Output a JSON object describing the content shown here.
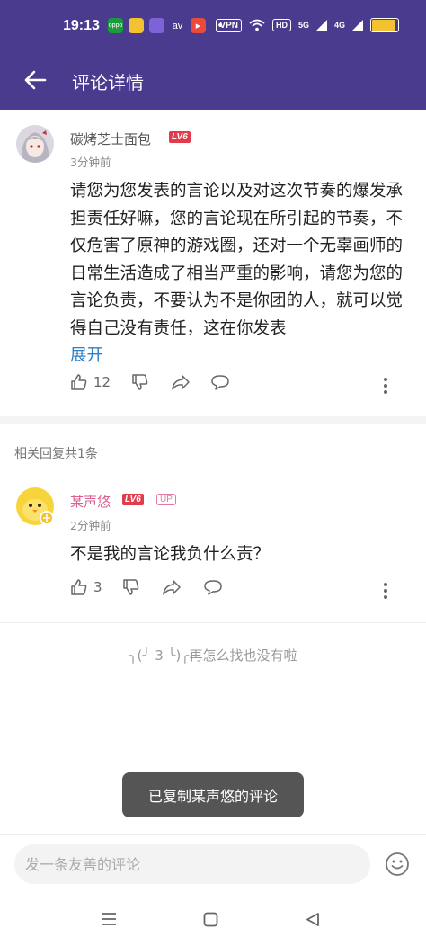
{
  "status": {
    "time": "19:13",
    "apps": [
      {
        "icon": "oppo-app-icon",
        "text": "oppo",
        "color": "#1a9c3c"
      },
      {
        "icon": "yellow-app-icon",
        "text": "",
        "color": "#f2c230"
      },
      {
        "icon": "purple-app-icon",
        "text": "",
        "color": "#7e62d8"
      },
      {
        "icon": "av-icon",
        "text": "av",
        "color": "transparent"
      },
      {
        "icon": "red-video-app-icon",
        "text": "▶",
        "color": "#e84b3c"
      }
    ],
    "vpn": "VPN",
    "hd": "HD",
    "sig1": "5G",
    "sig2": "4G",
    "battery_level": 0.85
  },
  "header": {
    "title": "评论详情"
  },
  "main_comment": {
    "username": "碳烤芝士面包",
    "level": "LV6",
    "time": "3分钟前",
    "text": "请您为您发表的言论以及对这次节奏的爆发承担责任好嘛，您的言论现在所引起的节奏，不仅危害了原神的游戏圈，还对一个无辜画师的日常生活造成了相当严重的影响，请您为您的言论负责，不要认为不是你团的人，就可以觉得自己没有责任，这在你发表",
    "expand": "展开",
    "likes": "12"
  },
  "replies_label": "相关回复共1条",
  "reply": {
    "username": "某声悠",
    "level": "LV6",
    "up_badge": "UP",
    "time": "2分钟前",
    "text": "不是我的言论我负什么责？",
    "likes": "3"
  },
  "end_text": "╮(╯ 3 ╰)╭再怎么找也没有啦",
  "toast": "已复制某声悠的评论",
  "input": {
    "placeholder": "发一条友善的评论"
  },
  "colors": {
    "brand": "#4b3b8f",
    "level_badge": "#e23b4c",
    "link": "#2f7fc6",
    "up": "#e07aa5"
  }
}
